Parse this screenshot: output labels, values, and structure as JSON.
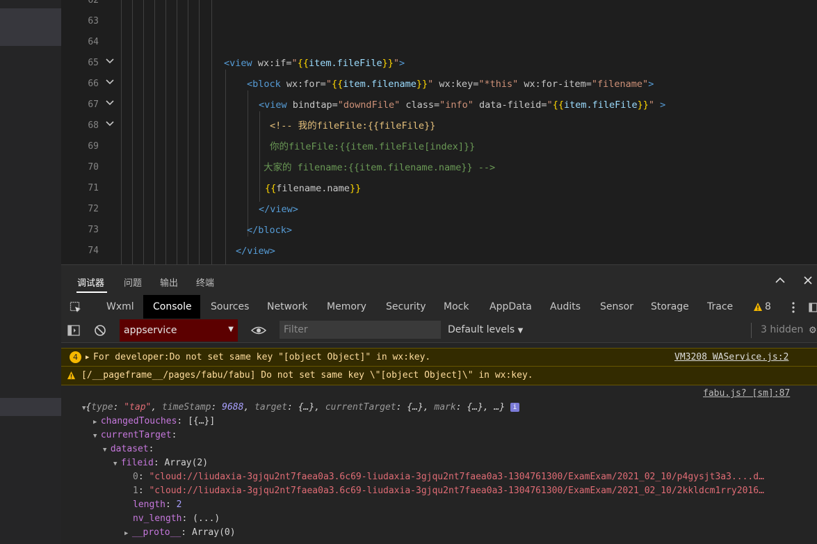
{
  "editor": {
    "line_numbers": [
      "62",
      "63",
      "64",
      "65",
      "66",
      "67",
      "68",
      "69",
      "70",
      "71",
      "72",
      "73",
      "74"
    ],
    "lines": [
      {
        "tag_open": "<view",
        "a1": " wx:if=",
        "v1_q": "\"",
        "v1_b1": "{{",
        "v1_e": "item.fileFile",
        "v1_b2": "}}",
        "v1_q2": "\"",
        "close": ">"
      },
      {
        "tag_open": "<block",
        "a1": " wx:for=",
        "v1_q": "\"",
        "v1_b1": "{{",
        "v1_e": "item.filename",
        "v1_b2": "}}",
        "v1_q2": "\"",
        "a2": " wx:key=",
        "v2": "\"*this\"",
        "a3": " wx:for-item=",
        "v3": "\"filename\"",
        "close": ">"
      },
      {
        "tag_open": "<view",
        "a1": " bindtap=",
        "v1": "\"downdFile\"",
        "a2": " class=",
        "v2": "\"info\"",
        "a3": " data-fileid=",
        "v3_q": "\"",
        "v3_b1": "{{",
        "v3_e": "item.fileFile",
        "v3_b2": "}}",
        "v3_q2": "\"",
        "close": " >"
      },
      {
        "text": "<!-- 我的fileFile:{{fileFile}}"
      },
      {
        "text": "你的fileFile:{{item.fileFile[index]}}"
      },
      {
        "text": "大家的 filename:{{item.filename.name}} -->"
      },
      {
        "b1": "{{",
        "e": "filename.name",
        "b2": "}}"
      },
      {
        "text": "</view>"
      },
      {
        "text": "</block>"
      },
      {
        "text": "</view>"
      }
    ]
  },
  "drawer_tabs": [
    "调试器",
    "问题",
    "输出",
    "终端"
  ],
  "main_tabs": [
    "Wxml",
    "Console",
    "Sources",
    "Network",
    "Memory",
    "Security",
    "Mock",
    "AppData",
    "Audits",
    "Sensor",
    "Storage",
    "Trace"
  ],
  "warning_count": "8",
  "console_toolbar": {
    "context": "appservice",
    "filter_placeholder": "Filter",
    "levels": "Default levels",
    "hidden": "3 hidden"
  },
  "console": {
    "warn1": {
      "badge": "4",
      "text": "For developer:Do not set same key \"[object Object]\" in wx:key.",
      "source": "VM3208 WAService.js:2"
    },
    "warn2": {
      "text": "[/__pageframe__/pages/fabu/fabu] Do not set same key \\\"[object Object]\\\" in wx:key."
    },
    "log_source": "fabu.js? [sm]:87",
    "obj_summary": {
      "type_key": "type",
      "type_val": "\"tap\"",
      "ts_key": "timeStamp",
      "ts_val": "9688",
      "target_key": "target",
      "ct_key": "currentTarget",
      "mark_key": "mark",
      "rest": "{…}"
    },
    "changedTouches": {
      "key": "changedTouches",
      "val": "[{…}]"
    },
    "currentTarget": {
      "key": "currentTarget"
    },
    "dataset": {
      "key": "dataset"
    },
    "fileid": {
      "key": "fileid",
      "val": "Array(2)"
    },
    "items": [
      {
        "idx": "0",
        "val": "\"cloud://liudaxia-3gjqu2nt7faea0a3.6c69-liudaxia-3gjqu2nt7faea0a3-1304761300/ExamExam/2021_02_10/p4gysjt3a3....d…"
      },
      {
        "idx": "1",
        "val": "\"cloud://liudaxia-3gjqu2nt7faea0a3.6c69-liudaxia-3gjqu2nt7faea0a3-1304761300/ExamExam/2021_02_10/2kkldcm1rry2016…"
      }
    ],
    "length": {
      "key": "length",
      "val": "2"
    },
    "nv_length": {
      "key": "nv_length",
      "val": "(...)"
    },
    "proto": {
      "key": "__proto__",
      "val": "Array(0)"
    }
  }
}
